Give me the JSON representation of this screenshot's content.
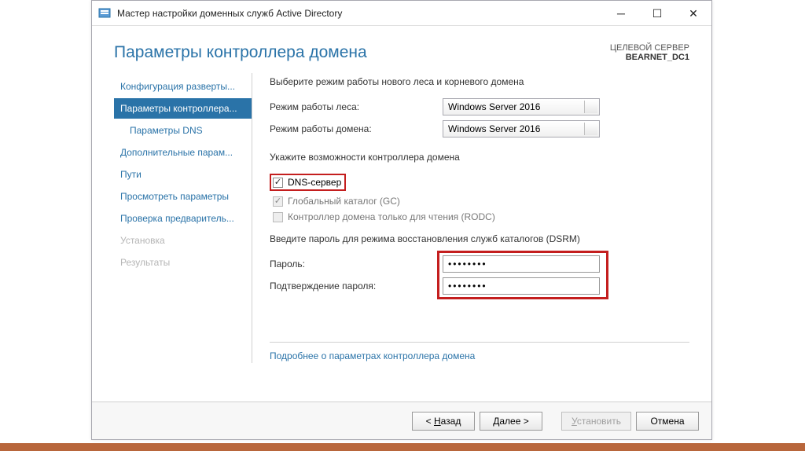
{
  "window": {
    "title": "Мастер настройки доменных служб Active Directory"
  },
  "header": {
    "title": "Параметры контроллера домена",
    "target_label": "ЦЕЛЕВОЙ СЕРВЕР",
    "target_name": "BEARNET_DC1"
  },
  "sidebar": {
    "items": [
      {
        "label": "Конфигурация разверты...",
        "active": false,
        "indent": false,
        "disabled": false
      },
      {
        "label": "Параметры контроллера...",
        "active": true,
        "indent": false,
        "disabled": false
      },
      {
        "label": "Параметры DNS",
        "active": false,
        "indent": true,
        "disabled": false
      },
      {
        "label": "Дополнительные парам...",
        "active": false,
        "indent": false,
        "disabled": false
      },
      {
        "label": "Пути",
        "active": false,
        "indent": false,
        "disabled": false
      },
      {
        "label": "Просмотреть параметры",
        "active": false,
        "indent": false,
        "disabled": false
      },
      {
        "label": "Проверка предваритель...",
        "active": false,
        "indent": false,
        "disabled": false
      },
      {
        "label": "Установка",
        "active": false,
        "indent": false,
        "disabled": true
      },
      {
        "label": "Результаты",
        "active": false,
        "indent": false,
        "disabled": true
      }
    ]
  },
  "main": {
    "func_mode_heading": "Выберите режим работы нового леса и корневого домена",
    "forest_label": "Режим работы леса:",
    "forest_value": "Windows Server 2016",
    "domain_label": "Режим работы домена:",
    "domain_value": "Windows Server 2016",
    "capabilities_heading": "Укажите возможности контроллера домена",
    "cb_dns": "DNS-сервер",
    "cb_gc": "Глобальный каталог (GC)",
    "cb_rodc": "Контроллер домена только для чтения (RODC)",
    "dsrm_heading": "Введите пароль для режима восстановления служб каталогов (DSRM)",
    "password_label": "Пароль:",
    "password_value": "••••••••",
    "confirm_label": "Подтверждение пароля:",
    "confirm_value": "••••••••",
    "link": "Подробнее о параметрах контроллера домена"
  },
  "footer": {
    "back_pre": "< ",
    "back_u": "Н",
    "back_post": "азад",
    "next_pre": "",
    "next_u": "Д",
    "next_post": "алее >",
    "install_pre": "",
    "install_u": "У",
    "install_post": "становить",
    "cancel": "Отмена"
  }
}
